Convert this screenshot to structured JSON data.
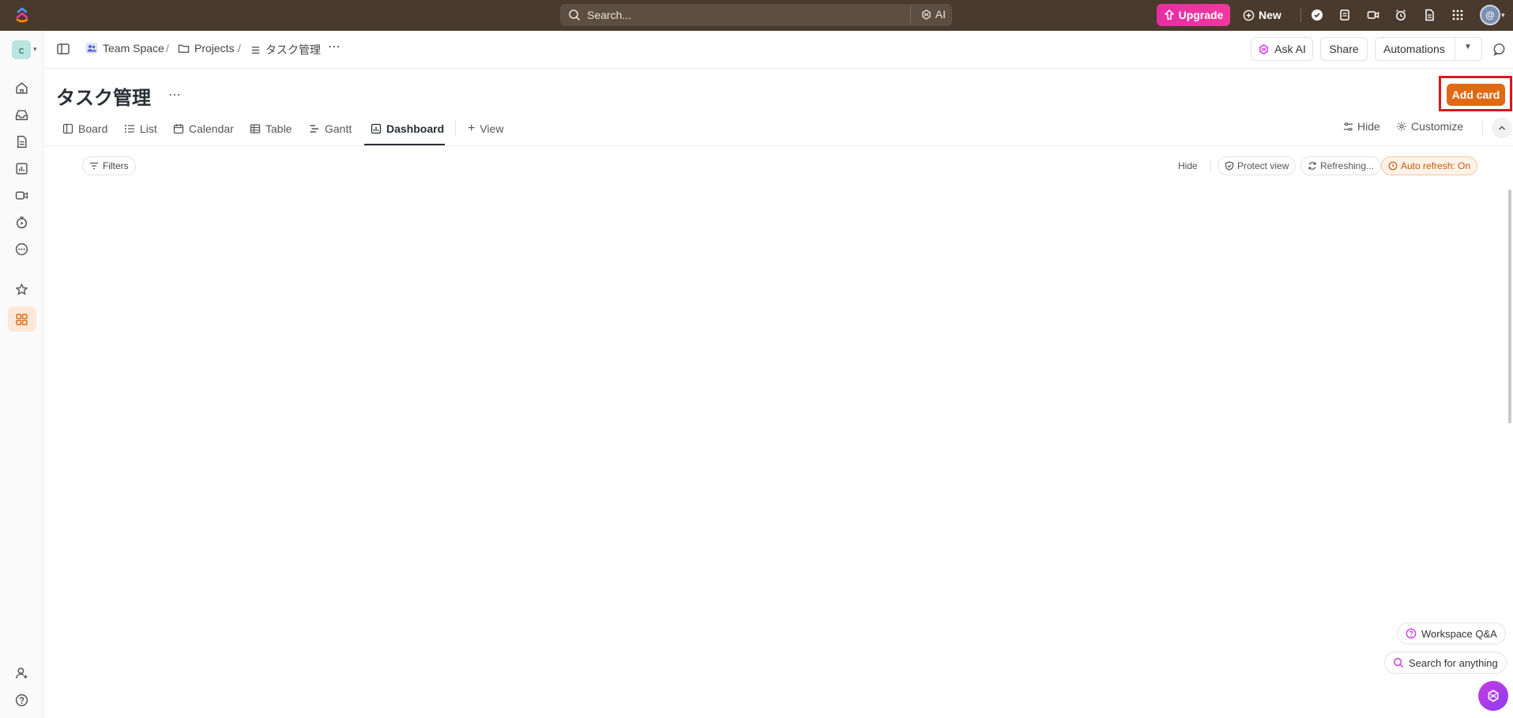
{
  "topbar": {
    "search_placeholder": "Search...",
    "ai_label": "AI",
    "upgrade_label": "Upgrade",
    "new_label": "New",
    "avatar_initial": "@"
  },
  "sidebar": {
    "workspace_initial": "c",
    "items": [
      "home-icon",
      "inbox-icon",
      "docs-icon",
      "dashboards-icon",
      "clips-icon",
      "timesheets-icon",
      "more-icon",
      "favorites-icon",
      "spaces-icon",
      "invite-icon",
      "help-icon"
    ]
  },
  "breadcrumb": {
    "team_space": "Team Space",
    "projects": "Projects",
    "list": "タスク管理",
    "sep": "/"
  },
  "header": {
    "ask_ai": "Ask AI",
    "share": "Share",
    "automations": "Automations"
  },
  "page": {
    "title": "タスク管理",
    "add_card": "Add card"
  },
  "tabs": {
    "items": [
      {
        "label": "Board"
      },
      {
        "label": "List"
      },
      {
        "label": "Calendar"
      },
      {
        "label": "Table"
      },
      {
        "label": "Gantt"
      },
      {
        "label": "Dashboard",
        "active": true
      }
    ],
    "add_view": "View",
    "hide": "Hide",
    "customize": "Customize"
  },
  "filterbar": {
    "filters": "Filters",
    "hide": "Hide",
    "protect_view": "Protect view",
    "refreshing": "Refreshing...",
    "auto_refresh": "Auto refresh: On"
  },
  "widgets": {
    "workspace_qa": "Workspace Q&A",
    "search_anything": "Search for anything"
  },
  "colors": {
    "topbar": "#4a3a2e",
    "accent": "#e06a13",
    "upgrade": "#e62ea2",
    "highlight": "#e0141c"
  }
}
